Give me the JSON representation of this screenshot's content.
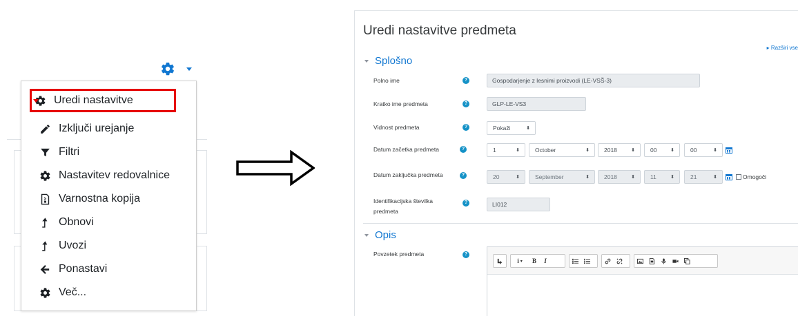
{
  "colors": {
    "accent": "#1177d1",
    "highlight": "#e60000",
    "help": "#1592c7"
  },
  "menu": {
    "items": [
      {
        "label": "Uredi nastavitve",
        "icon": "gear-icon",
        "highlighted": true
      },
      {
        "label": "Izključi urejanje",
        "icon": "pencil-icon"
      },
      {
        "label": "Filtri",
        "icon": "filter-icon"
      },
      {
        "label": "Nastavitev redovalnice",
        "icon": "gear-icon"
      },
      {
        "label": "Varnostna kopija",
        "icon": "backup-file-icon"
      },
      {
        "label": "Obnovi",
        "icon": "upload-arrow-icon"
      },
      {
        "label": "Uvozi",
        "icon": "upload-arrow-icon"
      },
      {
        "label": "Ponastavi",
        "icon": "arrow-left-icon"
      },
      {
        "label": "Več...",
        "icon": "gear-icon"
      }
    ]
  },
  "form": {
    "title": "Uredi nastavitve predmeta",
    "expand_all": "Razširi vse",
    "sections": {
      "general": "Splošno",
      "description": "Opis"
    },
    "fields": {
      "fullname": {
        "label": "Polno ime",
        "value": "Gospodarjenje z lesnimi proizvodi (LE-VSŠ-3)"
      },
      "shortname": {
        "label": "Kratko ime predmeta",
        "value": "GLP-LE-VS3"
      },
      "visibility": {
        "label": "Vidnost predmeta",
        "value": "Pokaži"
      },
      "startdate": {
        "label": "Datum začetka predmeta",
        "day": "1",
        "month": "October",
        "year": "2018",
        "hour": "00",
        "minute": "00"
      },
      "enddate": {
        "label": "Datum zaključka predmeta",
        "day": "20",
        "month": "September",
        "year": "2018",
        "hour": "11",
        "minute": "21",
        "enable_label": "Omogoči"
      },
      "idnumber": {
        "label_line1": "Identifikacijska številka",
        "label_line2": "predmeta",
        "value": "LI012"
      },
      "summary": {
        "label": "Povzetek predmeta"
      }
    },
    "toolbar": {
      "bold": "B",
      "italic": "I",
      "info": "i"
    }
  }
}
